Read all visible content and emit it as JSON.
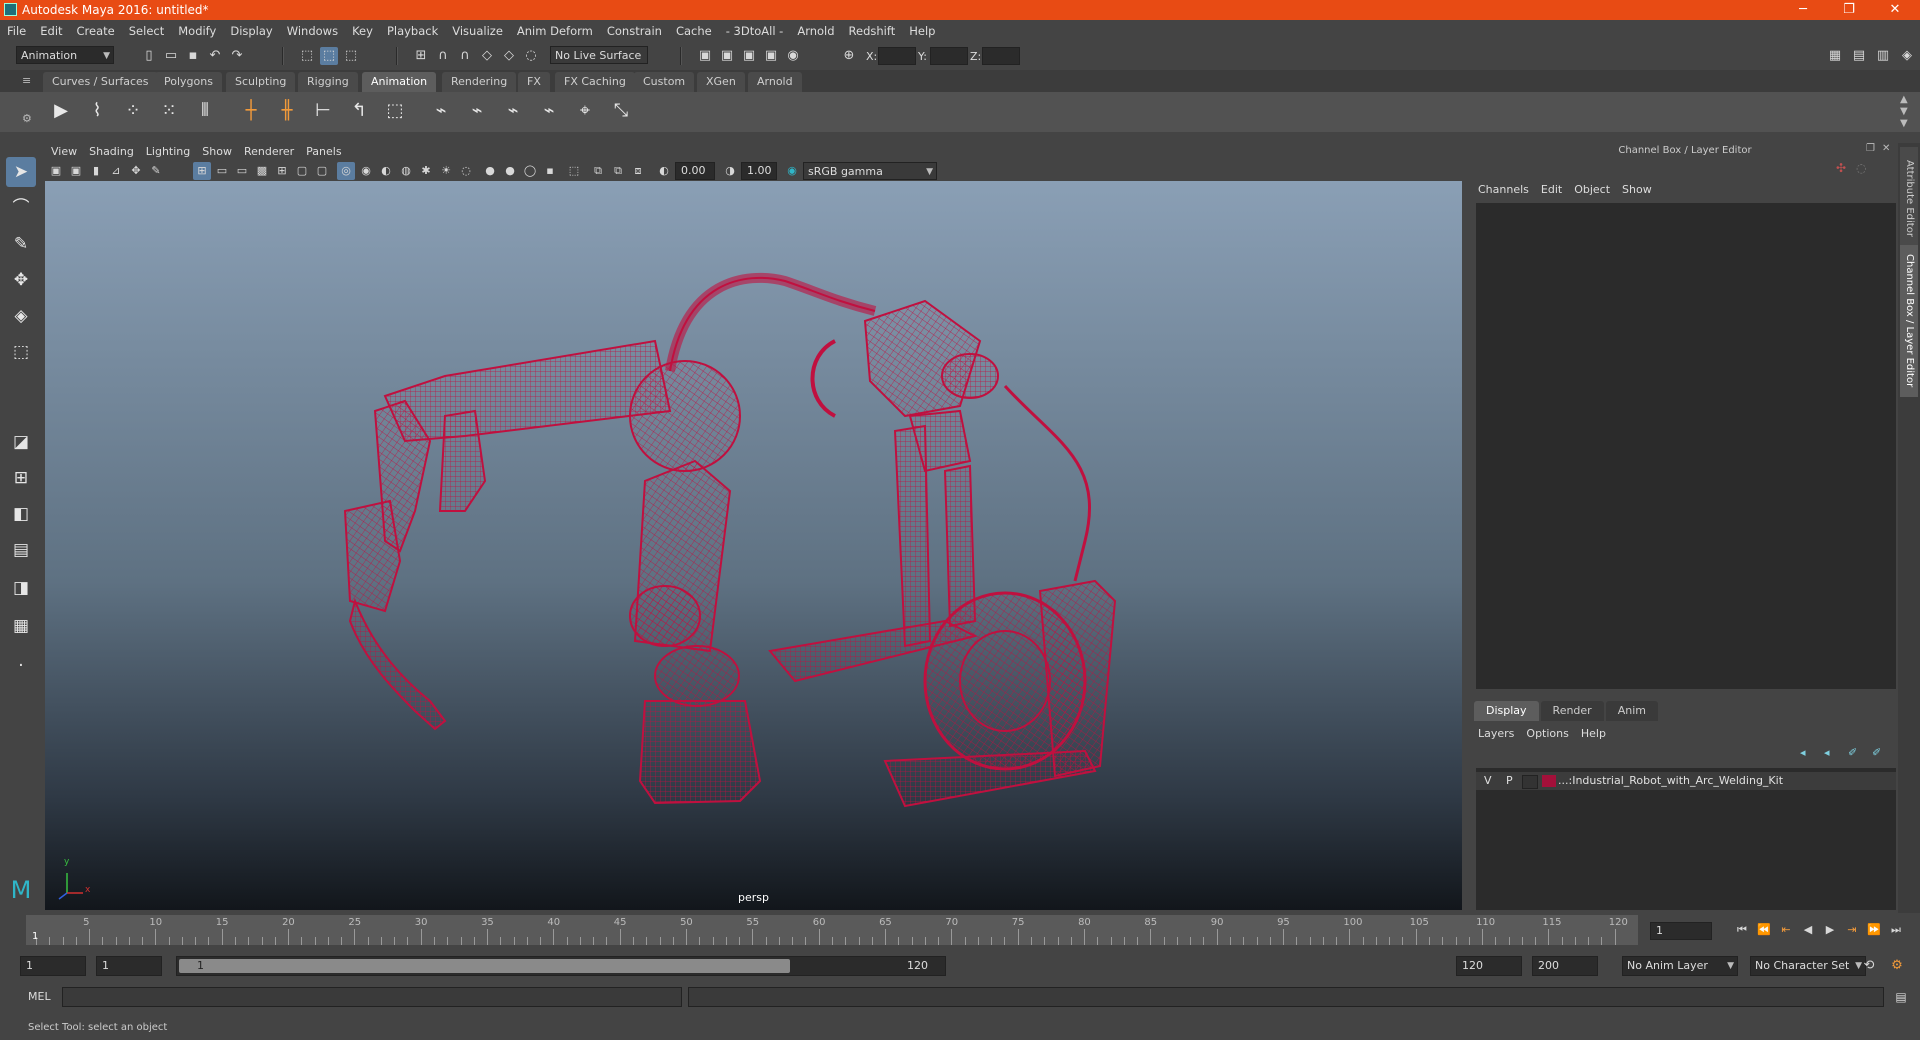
{
  "window": {
    "title": "Autodesk Maya 2016: untitled*",
    "minimize": "─",
    "restore": "❐",
    "close": "✕"
  },
  "menubar": [
    "File",
    "Edit",
    "Create",
    "Select",
    "Modify",
    "Display",
    "Windows",
    "Key",
    "Playback",
    "Visualize",
    "Anim Deform",
    "Constrain",
    "Cache",
    "- 3DtoAll -",
    "Arnold",
    "Redshift",
    "Help"
  ],
  "status_line": {
    "menu_set": "Animation",
    "live_surface": "No Live Surface",
    "coord_x_label": "X:",
    "coord_y_label": "Y:",
    "coord_z_label": "Z:"
  },
  "shelf_tabs": [
    "Curves / Surfaces",
    "Polygons",
    "Sculpting",
    "Rigging",
    "Animation",
    "Rendering",
    "FX",
    "FX Caching",
    "Custom",
    "XGen",
    "Arnold"
  ],
  "shelf_active_tab": "Animation",
  "viewport": {
    "menu": [
      "View",
      "Shading",
      "Lighting",
      "Show",
      "Renderer",
      "Panels"
    ],
    "exposure": "0.00",
    "gamma": "1.00",
    "color_space": "sRGB gamma",
    "camera_label": "persp",
    "axis_y": "y",
    "axis_x": "x",
    "wireframe_color": "#c0103f"
  },
  "channel_box": {
    "title": "Channel Box / Layer Editor",
    "menu": [
      "Channels",
      "Edit",
      "Object",
      "Show"
    ]
  },
  "layer_editor": {
    "tabs": [
      "Display",
      "Render",
      "Anim"
    ],
    "active_tab": "Display",
    "menu": [
      "Layers",
      "Options",
      "Help"
    ],
    "layer": {
      "v": "V",
      "p": "P",
      "color": "#a3103a",
      "name": "...:Industrial_Robot_with_Arc_Welding_Kit"
    }
  },
  "side_tabs": [
    "Attribute Editor",
    "Channel Box / Layer Editor"
  ],
  "time_slider": {
    "ticks": [
      "5",
      "10",
      "15",
      "20",
      "25",
      "30",
      "35",
      "40",
      "45",
      "50",
      "55",
      "60",
      "65",
      "70",
      "75",
      "80",
      "85",
      "90",
      "95",
      "100",
      "105",
      "110",
      "115",
      "120"
    ],
    "current_frame": "1",
    "current_frame_field": "1"
  },
  "range_slider": {
    "start_field": "1",
    "playback_start": "1",
    "range_start_label": "1",
    "range_end_label": "120",
    "playback_end": "120",
    "end_field": "200",
    "range_fill_fraction": 0.8,
    "anim_layer": "No Anim Layer",
    "character_set": "No Character Set"
  },
  "command_line": {
    "label": "MEL"
  },
  "help_line": "Select Tool: select an object"
}
